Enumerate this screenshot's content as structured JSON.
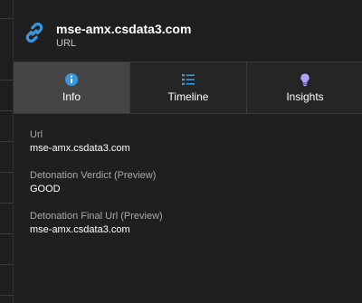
{
  "header": {
    "title": "mse-amx.csdata3.com",
    "subtitle": "URL",
    "icon": "link-icon"
  },
  "tabs": [
    {
      "label": "Info",
      "icon": "info-icon",
      "active": true
    },
    {
      "label": "Timeline",
      "icon": "list-icon",
      "active": false
    },
    {
      "label": "Insights",
      "icon": "lightbulb-icon",
      "active": false
    }
  ],
  "fields": [
    {
      "label": "Url",
      "value": "mse-amx.csdata3.com"
    },
    {
      "label": "Detonation Verdict (Preview)",
      "value": "GOOD"
    },
    {
      "label": "Detonation Final Url (Preview)",
      "value": "mse-amx.csdata3.com"
    }
  ],
  "colors": {
    "accent": "#3a96dd",
    "insights_accent": "#b4a0ff",
    "active_tab_bg": "#454545"
  }
}
